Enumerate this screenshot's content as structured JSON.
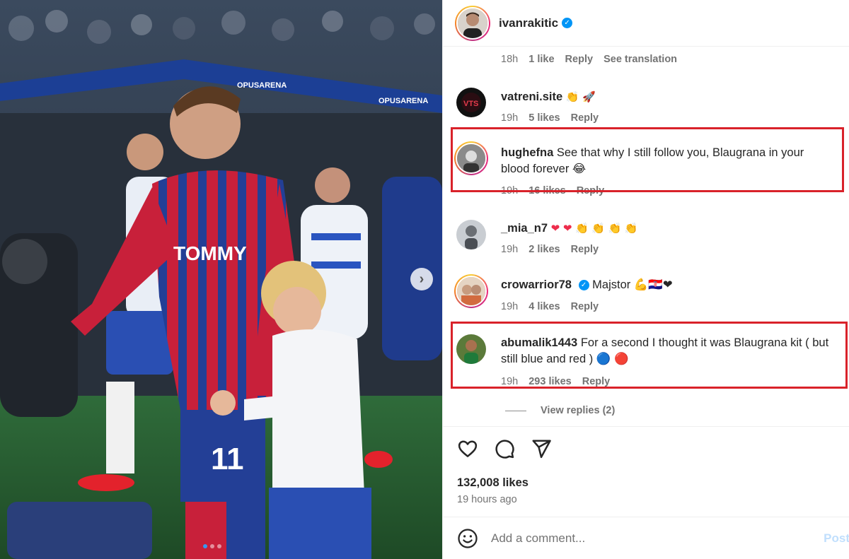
{
  "post": {
    "author": "ivanrakitic",
    "likes_count": "132,008 likes",
    "posted_ago": "19 hours ago",
    "carousel_index": 1,
    "carousel_total": 3
  },
  "top_meta": {
    "time": "18h",
    "likes": "1 like",
    "reply": "Reply",
    "translation": "See translation"
  },
  "comments": [
    {
      "username": "vatreni.site",
      "text": "",
      "emojis": [
        "👏",
        "🚀"
      ],
      "time": "19h",
      "likes": "5 likes",
      "reply": "Reply"
    },
    {
      "username": "hughefna",
      "text": "See that why I still follow you, Blaugrana in your blood forever 😂",
      "time": "19h",
      "likes": "16 likes",
      "reply": "Reply",
      "highlighted": true
    },
    {
      "username": "_mia_n7",
      "text": "",
      "emojis": [
        "❤",
        "❤",
        "👏",
        "👏",
        "👏",
        "👏"
      ],
      "time": "19h",
      "likes": "2 likes",
      "reply": "Reply"
    },
    {
      "username": "crowarrior78",
      "verified": true,
      "text": "Majstor 💪🇭🇷❤",
      "time": "19h",
      "likes": "4 likes",
      "reply": "Reply"
    },
    {
      "username": "abumalik1443",
      "text": "For a second I thought it was Blaugrana kit ( but still blue and red ) 🔵 🔴",
      "time": "19h",
      "likes": "293 likes",
      "reply": "Reply",
      "highlighted": true
    }
  ],
  "view_replies": "View replies (2)",
  "add_comment": {
    "placeholder": "Add a comment...",
    "post_label": "Post"
  },
  "colors": {
    "highlight": "#d9222a",
    "verified": "#0095f6",
    "heart": "#ed2d4c"
  },
  "photo": {
    "sponsor_text": "TOMMY",
    "arena_banner": "OPUSARENA",
    "shirt_number": "11"
  }
}
